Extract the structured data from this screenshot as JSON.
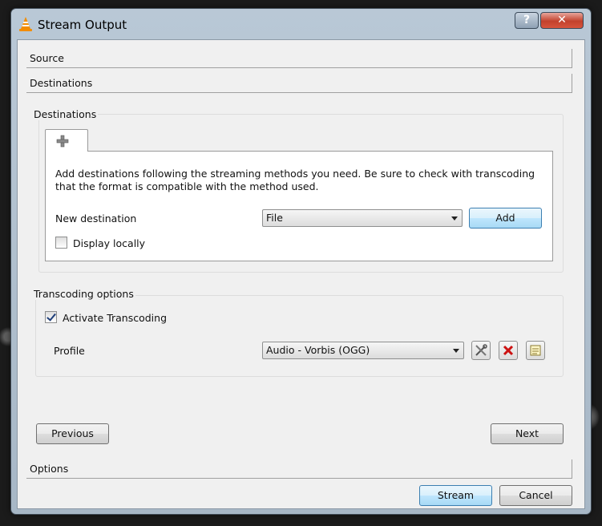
{
  "window": {
    "title": "Stream Output",
    "help_glyph": "?",
    "close_glyph": "✕"
  },
  "sections": {
    "source": "Source",
    "destinations": "Destinations",
    "options": "Options"
  },
  "destinations_group": {
    "title": "Destinations",
    "tab_icon": "plus-icon",
    "description": "Add destinations following the streaming methods you need. Be sure to check with transcoding that the format is compatible with the method used.",
    "new_destination_label": "New destination",
    "new_destination_value": "File",
    "add_label": "Add",
    "display_locally_label": "Display locally",
    "display_locally_checked": false
  },
  "transcoding_group": {
    "title": "Transcoding options",
    "activate_label": "Activate Transcoding",
    "activate_checked": true,
    "profile_label": "Profile",
    "profile_value": "Audio - Vorbis (OGG)",
    "icons": [
      "edit-profile-icon",
      "delete-profile-icon",
      "new-profile-icon"
    ]
  },
  "navigation": {
    "previous_label": "Previous",
    "next_label": "Next"
  },
  "footer": {
    "stream_label": "Stream",
    "cancel_label": "Cancel"
  },
  "colors": {
    "accent_button": "#bee6fd",
    "delete_red": "#cc1111"
  }
}
